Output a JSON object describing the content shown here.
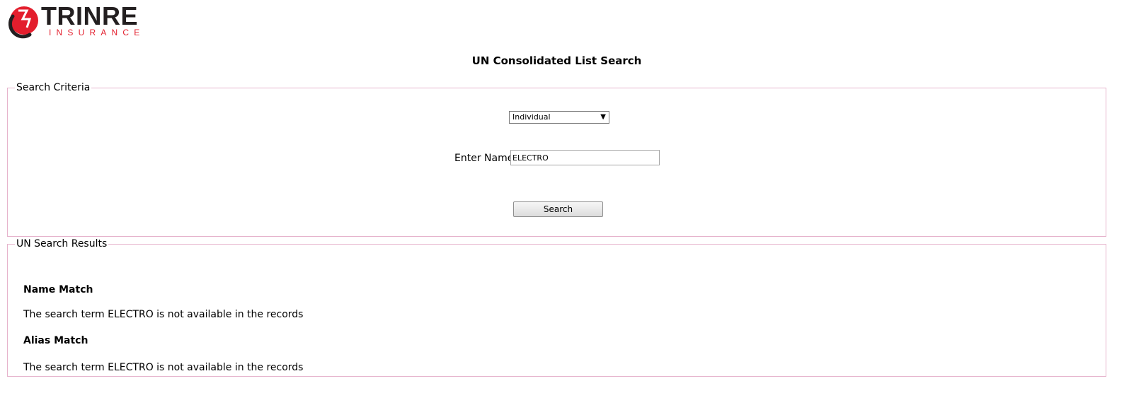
{
  "logo": {
    "wordmark": "TRINRE",
    "subtext": "INSURANCE",
    "brand_red": "#e31e2d",
    "brand_dark": "#231f20"
  },
  "page": {
    "title": "UN Consolidated List Search"
  },
  "criteria": {
    "legend": "Search Criteria",
    "type_select": {
      "selected": "Individual",
      "icon": "chevron-down-icon"
    },
    "name_label": "Enter Name",
    "name_value": "ELECTRO",
    "search_label": "Search"
  },
  "results": {
    "legend": "UN Search Results",
    "name_match": {
      "heading": "Name Match",
      "message": "The search term ELECTRO is not available in the records"
    },
    "alias_match": {
      "heading": "Alias Match",
      "message": "The search term ELECTRO is not available in the records"
    }
  },
  "colors": {
    "fieldset_border": "#e6b3cc"
  }
}
